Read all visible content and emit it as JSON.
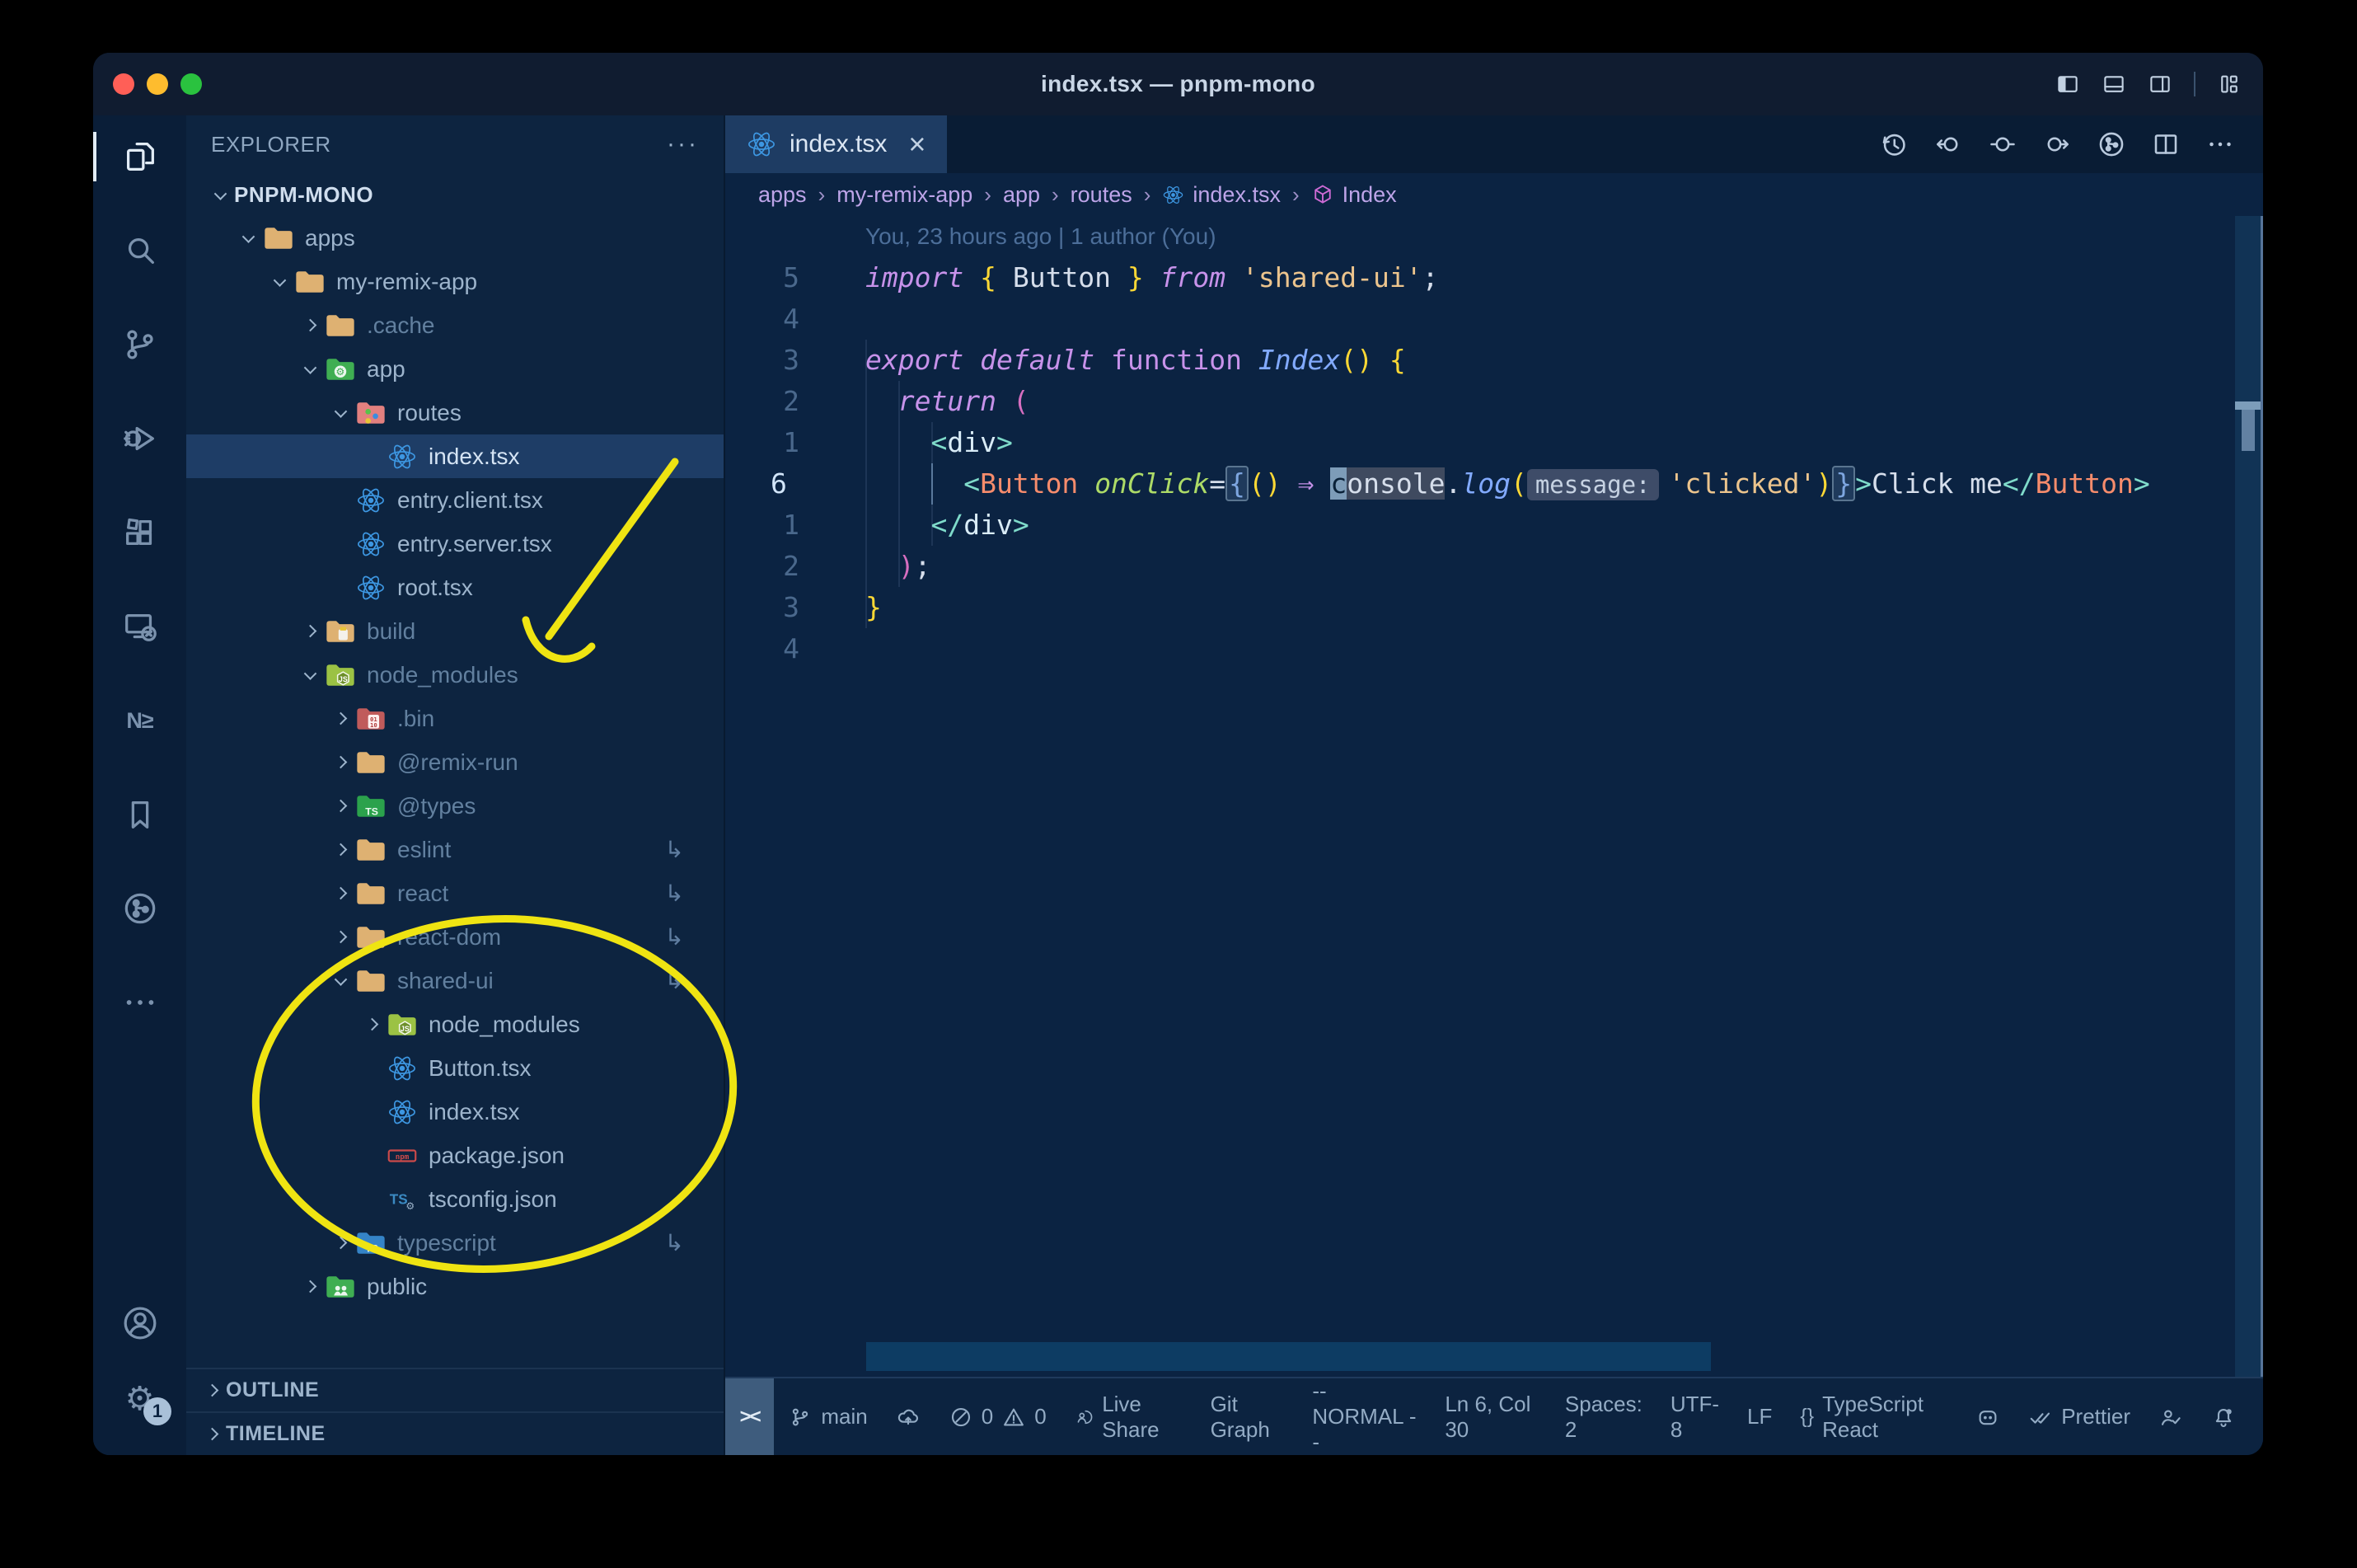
{
  "window": {
    "title": "index.tsx — pnpm-mono"
  },
  "window_controls": {
    "icons": [
      "toggle-sidebar",
      "toggle-panel",
      "toggle-secondary-sidebar",
      "customize-layout"
    ]
  },
  "activity_bar": {
    "top": [
      {
        "name": "explorer",
        "icon": "files",
        "active": true
      },
      {
        "name": "search",
        "icon": "search"
      },
      {
        "name": "source-control",
        "icon": "branch-lg"
      },
      {
        "name": "run-debug",
        "icon": "debug"
      },
      {
        "name": "extensions",
        "icon": "extensions"
      },
      {
        "name": "remote-explorer",
        "icon": "remote"
      },
      {
        "name": "nx-console",
        "icon": "nx",
        "text": "N≥"
      },
      {
        "name": "bookmarks",
        "icon": "bookmark"
      },
      {
        "name": "git-graph",
        "icon": "gitgraph"
      },
      {
        "name": "more",
        "icon": "more"
      }
    ],
    "bottom": [
      {
        "name": "accounts",
        "icon": "account"
      },
      {
        "name": "settings",
        "icon": "gear",
        "text": "⚙",
        "badge": "1"
      }
    ]
  },
  "explorer": {
    "header": "EXPLORER",
    "header_actions": "···",
    "project": "PNPM-MONO",
    "tree": [
      {
        "label": "apps",
        "icon": "folder-tan",
        "level": 1,
        "chevron": "down"
      },
      {
        "label": "my-remix-app",
        "icon": "folder-tan",
        "level": 2,
        "chevron": "down"
      },
      {
        "label": ".cache",
        "icon": "folder-tan",
        "level": 3,
        "chevron": "right",
        "dim": true
      },
      {
        "label": "app",
        "icon": "folder-app",
        "level": 3,
        "chevron": "down"
      },
      {
        "label": "routes",
        "icon": "folder-routes",
        "level": 4,
        "chevron": "down"
      },
      {
        "label": "index.tsx",
        "icon": "react",
        "level": 5,
        "selected": true
      },
      {
        "label": "entry.client.tsx",
        "icon": "react",
        "level": 4
      },
      {
        "label": "entry.server.tsx",
        "icon": "react",
        "level": 4
      },
      {
        "label": "root.tsx",
        "icon": "react",
        "level": 4
      },
      {
        "label": "build",
        "icon": "folder-build",
        "level": 3,
        "chevron": "right",
        "dim": true
      },
      {
        "label": "node_modules",
        "icon": "folder-nm",
        "level": 3,
        "chevron": "down",
        "dim": true
      },
      {
        "label": ".bin",
        "icon": "folder-bin",
        "level": 4,
        "chevron": "right",
        "dim": true
      },
      {
        "label": "@remix-run",
        "icon": "folder-tan",
        "level": 4,
        "chevron": "right",
        "dim": true
      },
      {
        "label": "@types",
        "icon": "folder-types",
        "level": 4,
        "chevron": "right",
        "dim": true
      },
      {
        "label": "eslint",
        "icon": "folder-tan",
        "level": 4,
        "chevron": "right",
        "dim": true,
        "symlink": true
      },
      {
        "label": "react",
        "icon": "folder-tan",
        "level": 4,
        "chevron": "right",
        "dim": true,
        "symlink": true
      },
      {
        "label": "react-dom",
        "icon": "folder-tan",
        "level": 4,
        "chevron": "right",
        "dim": true,
        "symlink": true
      },
      {
        "label": "shared-ui",
        "icon": "folder-tan",
        "level": 4,
        "chevron": "down",
        "dim": true,
        "symlink": true
      },
      {
        "label": "node_modules",
        "icon": "folder-nm",
        "level": 5,
        "chevron": "right"
      },
      {
        "label": "Button.tsx",
        "icon": "react",
        "level": 5
      },
      {
        "label": "index.tsx",
        "icon": "react",
        "level": 5
      },
      {
        "label": "package.json",
        "icon": "npm",
        "level": 5
      },
      {
        "label": "tsconfig.json",
        "icon": "tsjson",
        "level": 5
      },
      {
        "label": "typescript",
        "icon": "folder-ts",
        "level": 4,
        "chevron": "right",
        "dim": true,
        "symlink": true
      },
      {
        "label": "public",
        "icon": "folder-public",
        "level": 3,
        "chevron": "right"
      }
    ],
    "sections": [
      "OUTLINE",
      "TIMELINE"
    ],
    "symlink_glyph": "↳"
  },
  "editor": {
    "tab": {
      "label": "index.tsx",
      "close": "×",
      "icon": "react"
    },
    "toolbar_icons": [
      "file-history",
      "prev-change",
      "change",
      "next-change",
      "gitgraph",
      "split-editor",
      "more-actions"
    ],
    "breadcrumbs": {
      "separator": "›",
      "items": [
        {
          "label": "apps"
        },
        {
          "label": "my-remix-app"
        },
        {
          "label": "app"
        },
        {
          "label": "routes"
        },
        {
          "label": "index.tsx",
          "icon": "react"
        },
        {
          "label": "Index",
          "icon": "cube"
        }
      ]
    },
    "blame": "You, 23 hours ago | 1 author (You)",
    "lines": [
      {
        "num": "5",
        "tokens": [
          [
            "kw",
            "import"
          ],
          [
            "pl",
            " "
          ],
          [
            "y",
            "{"
          ],
          [
            "pl",
            " Button "
          ],
          [
            "y",
            "}"
          ],
          [
            "pl",
            " "
          ],
          [
            "kw",
            "from"
          ],
          [
            "pl",
            " "
          ],
          [
            "s",
            "'shared-ui'"
          ],
          [
            "pl",
            ";"
          ]
        ]
      },
      {
        "num": "4",
        "tokens": []
      },
      {
        "num": "3",
        "tokens": [
          [
            "kw",
            "export"
          ],
          [
            "pl",
            " "
          ],
          [
            "kw",
            "default"
          ],
          [
            "pl",
            " "
          ],
          [
            "kw2",
            "function"
          ],
          [
            "pl",
            " "
          ],
          [
            "fn",
            "Index"
          ],
          [
            "y",
            "()"
          ],
          [
            "pl",
            " "
          ],
          [
            "y",
            "{"
          ]
        ]
      },
      {
        "num": "2",
        "tokens": [
          [
            "pl",
            "  "
          ],
          [
            "kw",
            "return"
          ],
          [
            "pl",
            " "
          ],
          [
            "p",
            "("
          ]
        ]
      },
      {
        "num": "1",
        "tokens": [
          [
            "pl",
            "    "
          ],
          [
            "ab",
            "<"
          ],
          [
            "tag",
            "div"
          ],
          [
            "ab",
            ">"
          ]
        ]
      },
      {
        "num": "6",
        "current": true,
        "tokens": [
          [
            "pl",
            "      "
          ],
          [
            "ab",
            "<"
          ],
          [
            "cmp",
            "Button"
          ],
          [
            "pl",
            " "
          ],
          [
            "attr",
            "onClick"
          ],
          [
            "pl",
            "="
          ],
          [
            "brk",
            "{"
          ],
          [
            "y",
            "()"
          ],
          [
            "pl",
            " "
          ],
          [
            "arrow",
            "⇒"
          ],
          [
            "pl",
            " "
          ],
          [
            "cursor",
            "c"
          ],
          [
            "whl",
            "onsole"
          ],
          [
            "pl",
            "."
          ],
          [
            "fn",
            "log"
          ],
          [
            "y",
            "("
          ],
          [
            "inlay",
            "message:"
          ],
          [
            "s",
            "'clicked'"
          ],
          [
            "y",
            ")"
          ],
          [
            "brk",
            "}"
          ],
          [
            "ab",
            ">"
          ],
          [
            "pl",
            "Click me"
          ],
          [
            "ab",
            "</"
          ],
          [
            "cmp",
            "Button"
          ],
          [
            "ab",
            ">"
          ]
        ]
      },
      {
        "num": "1",
        "tokens": [
          [
            "pl",
            "    "
          ],
          [
            "ab",
            "</"
          ],
          [
            "tag",
            "div"
          ],
          [
            "ab",
            ">"
          ]
        ]
      },
      {
        "num": "2",
        "tokens": [
          [
            "pl",
            "  "
          ],
          [
            "p",
            ")"
          ],
          [
            "pl",
            ";"
          ]
        ]
      },
      {
        "num": "3",
        "tokens": [
          [
            "y",
            "}"
          ]
        ]
      },
      {
        "num": "4",
        "tokens": []
      }
    ]
  },
  "statusbar": {
    "remote_chip": "><",
    "left": [
      {
        "icon": "branch",
        "label": "main"
      },
      {
        "icon": "cloud"
      },
      {
        "icon": "error",
        "label": "0",
        "icon2": "warning",
        "label2": "0"
      },
      {
        "icon": "liveshare",
        "label": "Live Share"
      },
      {
        "label": "Git Graph"
      },
      {
        "label": "-- NORMAL --"
      }
    ],
    "right": [
      {
        "label": "Ln 6, Col 30"
      },
      {
        "label": "Spaces: 2"
      },
      {
        "label": "UTF-8"
      },
      {
        "label": "LF"
      },
      {
        "text_icon": "{}",
        "label": "TypeScript React"
      },
      {
        "icon": "robot"
      },
      {
        "icon": "checks",
        "label": "Prettier"
      },
      {
        "icon": "person-check"
      },
      {
        "icon": "bell"
      }
    ]
  },
  "colors": {
    "annotation_yellow": "#efe412",
    "selection_row": "#1e3d66",
    "accent_folder_tan": "#deb172",
    "traffic": [
      "#ff5f57",
      "#febc2e",
      "#2ac23f"
    ]
  }
}
